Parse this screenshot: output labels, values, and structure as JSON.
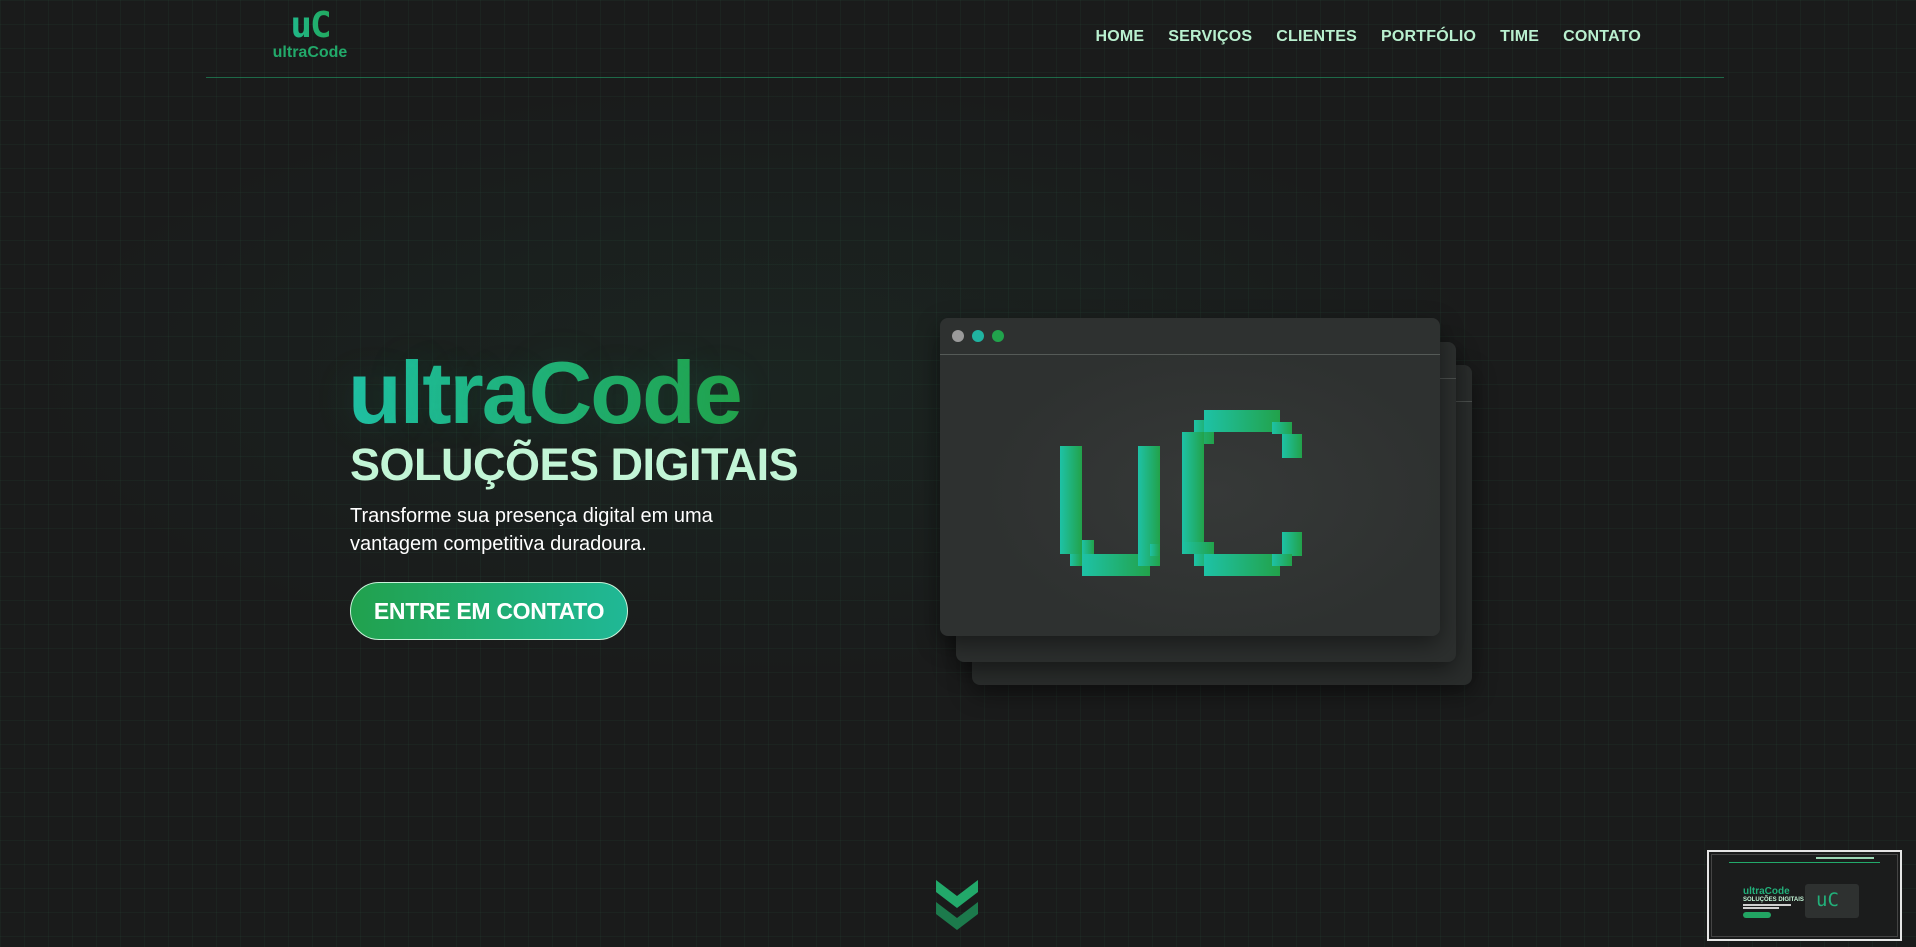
{
  "header": {
    "logo_mark": "uC",
    "logo_text": "ultraCode",
    "nav": [
      "HOME",
      "SERVIÇOS",
      "CLIENTES",
      "PORTFÓLIO",
      "TIME",
      "CONTATO"
    ]
  },
  "hero": {
    "title": "ultraCode",
    "subtitle": "SOLUÇÕES DIGITAIS",
    "description": "Transforme sua presença digital em uma vantagem competitiva duradoura.",
    "cta_label": "ENTRE EM CONTATO"
  },
  "browser_mock": {
    "logo_mark": "uC"
  },
  "minimap": {
    "title": "ultraCode",
    "subtitle": "SOLUÇÕES DIGITAIS",
    "logo_mark": "uC"
  },
  "colors": {
    "background": "#1a1b1b",
    "accent_teal": "#20bfa0",
    "accent_green": "#22a24a",
    "nav_text": "#b9f0cf",
    "subtitle": "#c2f5d6"
  },
  "icons": {
    "scroll": "chevron-double-down-icon",
    "window_dots": [
      "gray-dot-icon",
      "teal-dot-icon",
      "green-dot-icon"
    ]
  }
}
